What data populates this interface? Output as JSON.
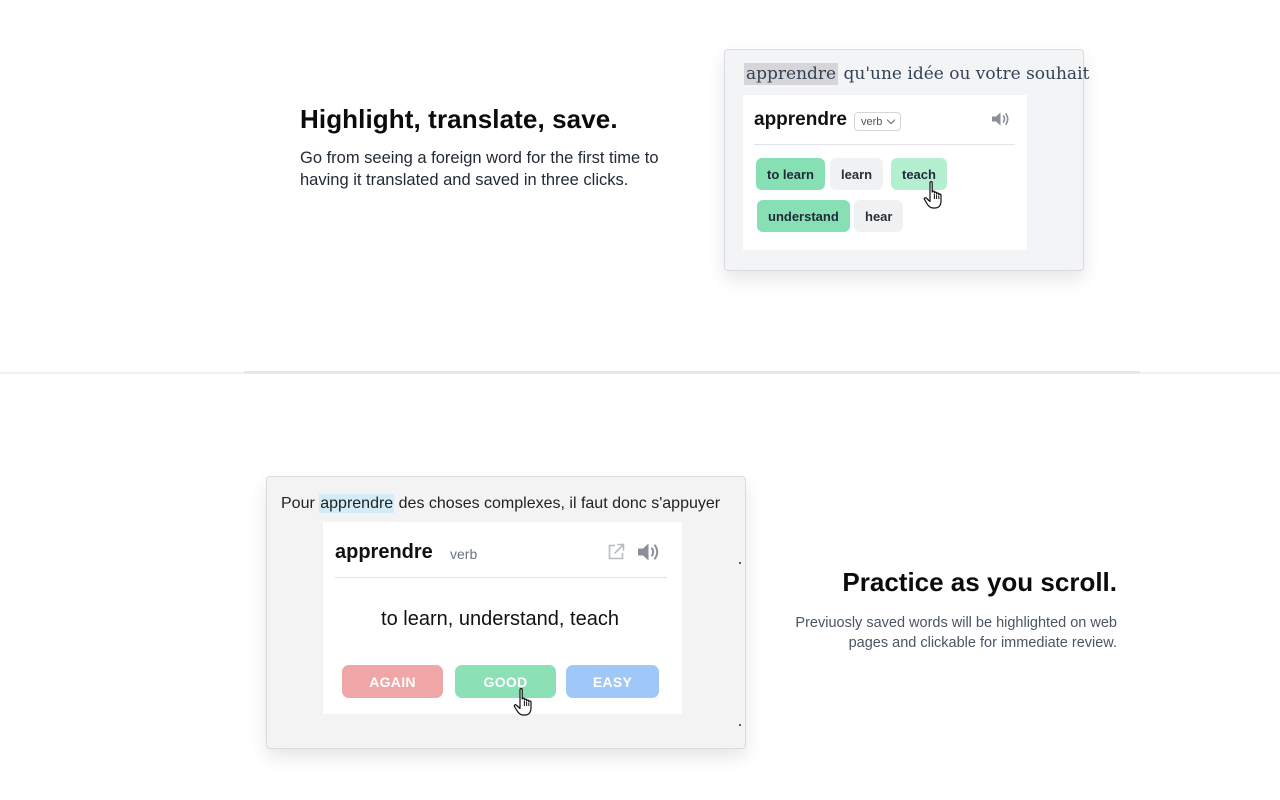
{
  "section1": {
    "title": "Highlight, translate, save.",
    "description": "Go from seeing a foreign word for the first time to having it translated and saved in three clicks.",
    "demo": {
      "sentence_highlight": "apprendre",
      "sentence_rest": " qu'une idée ou votre souhait",
      "word": "apprendre",
      "pos_selected": "verb",
      "icons": {
        "speaker": "speaker-icon",
        "chevron": "chevron-down-icon"
      },
      "chips": [
        {
          "label": "to learn",
          "state": "selected"
        },
        {
          "label": "learn",
          "state": "unselected"
        },
        {
          "label": "teach",
          "state": "hover"
        },
        {
          "label": "understand",
          "state": "selected"
        },
        {
          "label": "hear",
          "state": "unselected"
        }
      ]
    }
  },
  "section2": {
    "title": "Practice as you scroll.",
    "description": "Previuosly saved words will be highlighted on web pages and clickable for immediate review.",
    "demo": {
      "sentence_before": "Pour ",
      "sentence_highlight": "apprendre",
      "sentence_after": " des choses complexes, il faut donc s'appuyer",
      "word": "apprendre",
      "pos": "verb",
      "translation": "to learn, understand, teach",
      "icons": {
        "external": "external-link-icon",
        "speaker": "speaker-icon"
      },
      "buttons": {
        "again": "AGAIN",
        "good": "GOOD",
        "easy": "EASY"
      }
    }
  },
  "colors": {
    "chip_selected": "#86e0b3",
    "chip_hover": "#b4f0d0",
    "chip_unselected": "#f0f1f3",
    "again": "#f0a6a6",
    "good": "#8be0b5",
    "easy": "#9fc7f7",
    "highlight_gray": "#d6d6d8",
    "highlight_blue": "#d4ecf8"
  }
}
